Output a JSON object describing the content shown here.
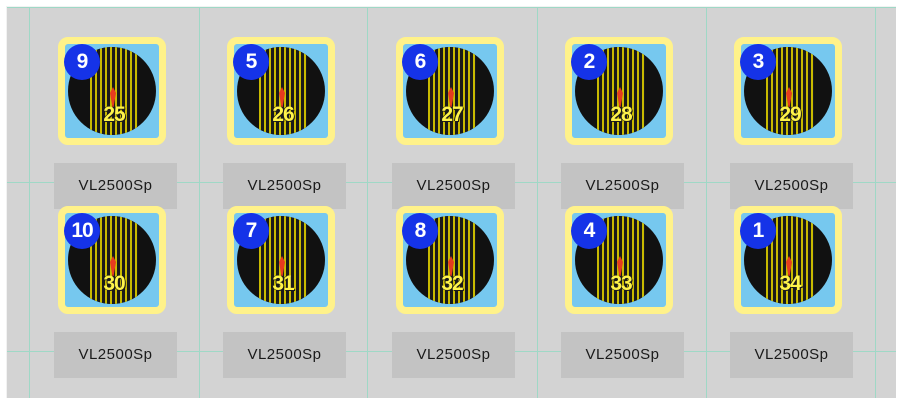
{
  "fixtures": [
    {
      "id": "9",
      "dmx": "25",
      "model": "VL2500Sp"
    },
    {
      "id": "5",
      "dmx": "26",
      "model": "VL2500Sp"
    },
    {
      "id": "6",
      "dmx": "27",
      "model": "VL2500Sp"
    },
    {
      "id": "2",
      "dmx": "28",
      "model": "VL2500Sp"
    },
    {
      "id": "3",
      "dmx": "29",
      "model": "VL2500Sp"
    },
    {
      "id": "10",
      "dmx": "30",
      "model": "VL2500Sp"
    },
    {
      "id": "7",
      "dmx": "31",
      "model": "VL2500Sp"
    },
    {
      "id": "8",
      "dmx": "32",
      "model": "VL2500Sp"
    },
    {
      "id": "4",
      "dmx": "33",
      "model": "VL2500Sp"
    },
    {
      "id": "1",
      "dmx": "34",
      "model": "VL2500Sp"
    }
  ],
  "colors": {
    "canvas": "#d3d3d3",
    "grid": "#9fd8c6",
    "tile_border": "#fff28a",
    "tile_fill": "#76c8ef",
    "badge": "#1533e8",
    "dmx_text": "#fff44a",
    "caption_bg": "#c3c3c3"
  },
  "icons": {
    "fixture": "spot-light-icon",
    "beam": "beam-pointer-icon"
  }
}
